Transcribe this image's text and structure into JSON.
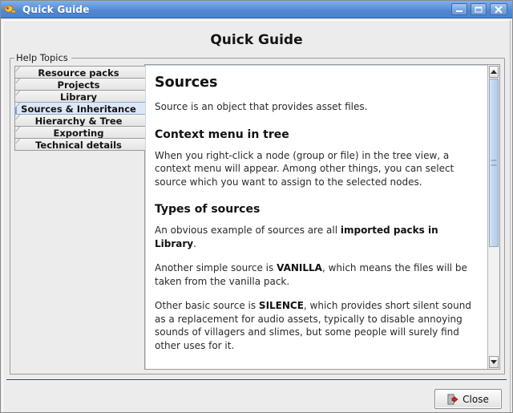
{
  "window": {
    "title": "Quick Guide",
    "icon": "key-icon",
    "controls": {
      "minimize_label": "Minimize",
      "maximize_label": "Maximize",
      "close_label": "Close"
    }
  },
  "dialog": {
    "heading": "Quick Guide",
    "group_title": "Help Topics"
  },
  "tabs": [
    {
      "label": "Resource packs",
      "selected": false
    },
    {
      "label": "Projects",
      "selected": false
    },
    {
      "label": "Library",
      "selected": false
    },
    {
      "label": "Sources & Inheritance",
      "selected": true
    },
    {
      "label": "Hierarchy & Tree",
      "selected": false
    },
    {
      "label": "Exporting",
      "selected": false
    },
    {
      "label": "Technical details",
      "selected": false
    }
  ],
  "content": {
    "title": "Sources",
    "intro": "Source is an object that provides asset files.",
    "sections": [
      {
        "heading": "Context menu in tree",
        "paragraphs": [
          "When you right-click a node (group or file) in the tree view, a context menu will appear. Among other things, you can select source which you want to assign to the selected nodes."
        ]
      },
      {
        "heading": "Types of sources",
        "paragraphs": [
          "An obvious example of sources are all <b>imported packs in Library</b>.",
          "Another simple source is <b>VANILLA</b>, which means the files will be taken from the vanilla pack.",
          "Other basic source is <b>SILENCE</b>, which provides short silent sound as a replacement for audio assets, typically to disable annoying sounds of villagers and slimes, but some people will surely find other uses for it."
        ]
      }
    ]
  },
  "scrollbar": {
    "up_label": "Scroll up",
    "down_label": "Scroll down",
    "thumb_position_percent": 0,
    "thumb_size_percent": 61
  },
  "footer": {
    "close_label": "Close",
    "close_icon": "exit-door-icon"
  },
  "colors": {
    "titlebar_start": "#7fb0e8",
    "titlebar_end": "#4a82cc",
    "selected_tab_bg": "#dce8f6",
    "panel_bg": "#ececec",
    "content_bg": "#ffffff",
    "scroll_thumb": "#b4cdea"
  }
}
